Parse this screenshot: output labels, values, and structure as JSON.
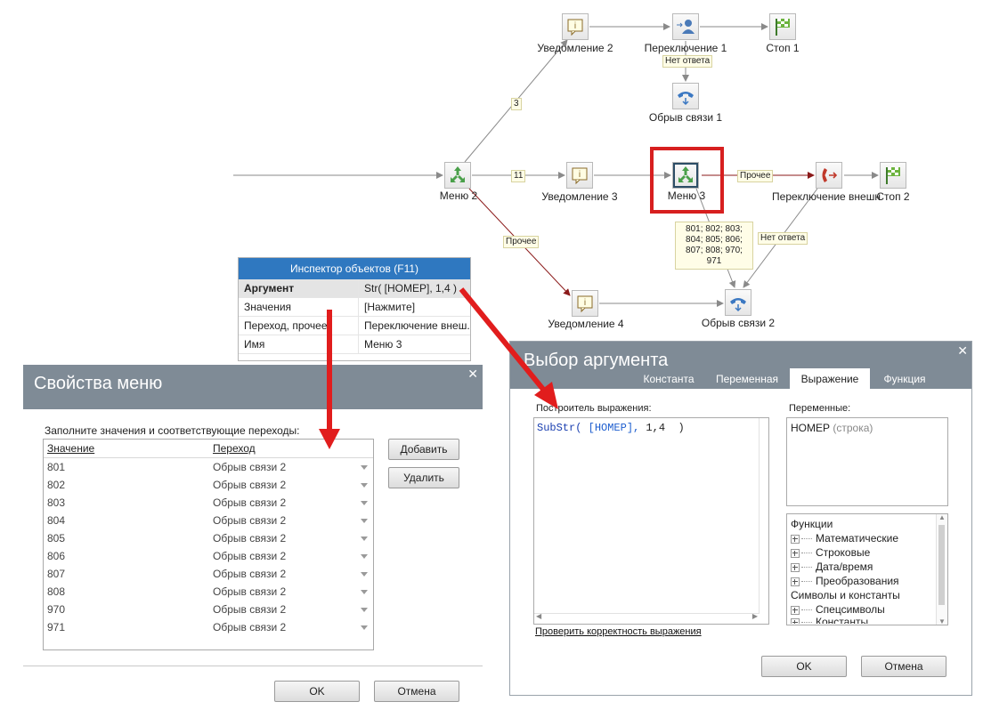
{
  "diagram": {
    "nodes": {
      "notify2": "Уведомление 2",
      "switch1": "Переключение 1",
      "stop1": "Стоп 1",
      "hangup1": "Обрыв связи 1",
      "menu2": "Меню 2",
      "notify3": "Уведомление 3",
      "menu3": "Меню 3",
      "switch_ext": "Переключение внешн",
      "stop2": "Стоп 2",
      "notify4": "Уведомление 4",
      "hangup2": "Обрыв связи 2"
    },
    "edges": {
      "no_answer_1": "Нет ответа",
      "three": "3",
      "eleven": "11",
      "other_menu3": "Прочее",
      "other_menu2": "Прочее",
      "no_answer_2": "Нет ответа",
      "codes": "801; 802; 803; 804; 805; 806; 807; 808; 970; 971"
    },
    "colors": {
      "highlight": "#d71f1f",
      "arrow": "#e11d1d",
      "edge": "#8a8a8a",
      "edge_active": "#8b1a1a"
    }
  },
  "inspector": {
    "title": "Инспектор объектов (F11)",
    "rows": [
      {
        "key": "Аргумент",
        "value": "Str( [НОМЕР], 1,4  )"
      },
      {
        "key": "Значения",
        "value": "[Нажмите]"
      },
      {
        "key": "Переход, прочее",
        "value": "Переключение внеш..."
      },
      {
        "key": "Имя",
        "value": "Меню 3"
      }
    ]
  },
  "menu_dialog": {
    "title": "Свойства меню",
    "instruction": "Заполните значения и соответствующие переходы:",
    "columns": [
      "Значение",
      "Переход"
    ],
    "rows": [
      {
        "value": "801",
        "target": "Обрыв связи 2"
      },
      {
        "value": "802",
        "target": "Обрыв связи 2"
      },
      {
        "value": "803",
        "target": "Обрыв связи 2"
      },
      {
        "value": "804",
        "target": "Обрыв связи 2"
      },
      {
        "value": "805",
        "target": "Обрыв связи 2"
      },
      {
        "value": "806",
        "target": "Обрыв связи 2"
      },
      {
        "value": "807",
        "target": "Обрыв связи 2"
      },
      {
        "value": "808",
        "target": "Обрыв связи 2"
      },
      {
        "value": "970",
        "target": "Обрыв связи 2"
      },
      {
        "value": "971",
        "target": "Обрыв связи 2"
      }
    ],
    "add_label": "Добавить",
    "delete_label": "Удалить",
    "ok_label": "OK",
    "cancel_label": "Отмена"
  },
  "arg_dialog": {
    "title": "Выбор аргумента",
    "tabs": [
      "Константа",
      "Переменная",
      "Выражение",
      "Функция"
    ],
    "active_tab": "Выражение",
    "builder_label": "Построитель выражения:",
    "expression": {
      "func": "SubStr(",
      "var": " [НОМЕР],",
      "rest": " 1,4  )"
    },
    "variables_label": "Переменные:",
    "variable": {
      "name": "НОМЕР",
      "type": "(строка)"
    },
    "tree": {
      "functions": "Функции",
      "items": [
        "Математические",
        "Строковые",
        "Дата/время",
        "Преобразования"
      ],
      "symbols": "Символы и константы",
      "sym_items": [
        "Спецсимволы",
        "Константы"
      ]
    },
    "check_link": "Проверить корректность выражения",
    "ok_label": "OK",
    "cancel_label": "Отмена"
  }
}
